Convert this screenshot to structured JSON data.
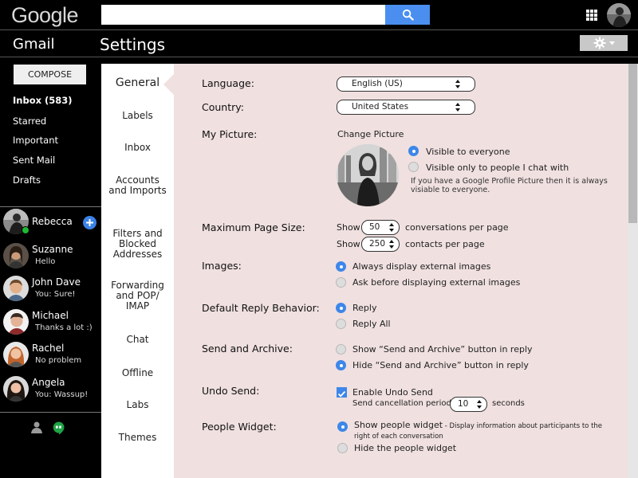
{
  "header": {
    "logo": "Google",
    "search_placeholder": "",
    "app_label": "Gmail",
    "page_title": "Settings"
  },
  "nav": {
    "compose_label": "COMPOSE",
    "items": [
      {
        "label": "Inbox (583)"
      },
      {
        "label": "Starred"
      },
      {
        "label": "Important"
      },
      {
        "label": "Sent Mail"
      },
      {
        "label": "Drafts"
      }
    ]
  },
  "chat": {
    "me": {
      "name": "Rebecca",
      "online": true
    },
    "contacts": [
      {
        "name": "Suzanne",
        "status": "Hello"
      },
      {
        "name": "John Dave",
        "status": "You: Sure!"
      },
      {
        "name": "Michael",
        "status": "Thanks a lot :)"
      },
      {
        "name": "Rachel",
        "status": "No problem"
      },
      {
        "name": "Angela",
        "status": "You: Wassup!"
      }
    ]
  },
  "tabs": [
    {
      "label": "General",
      "active": true
    },
    {
      "label": "Labels"
    },
    {
      "label": "Inbox"
    },
    {
      "label": "Accounts and Imports"
    },
    {
      "label": "Filters and Blocked Addresses"
    },
    {
      "label": "Forwarding and POP/ IMAP"
    },
    {
      "label": "Chat"
    },
    {
      "label": "Offline"
    },
    {
      "label": "Labs"
    },
    {
      "label": "Themes"
    }
  ],
  "settings": {
    "language": {
      "label": "Language:",
      "value": "English (US)"
    },
    "country": {
      "label": "Country:",
      "value": "United States"
    },
    "picture": {
      "label": "My Picture:",
      "change_link": "Change Picture",
      "opt_visible_all": "Visible to everyone",
      "opt_visible_chat": "Visible only to people I chat with",
      "note": "If you have a Google Profile Picture then it is always visiable to everyone."
    },
    "page_size": {
      "label": "Maximum Page Size:",
      "show1": "Show",
      "conversations_value": "50",
      "conversations_suffix": "conversations per page",
      "show2": "Show",
      "contacts_value": "250",
      "contacts_suffix": "contacts per page"
    },
    "images": {
      "label": "Images:",
      "opt_always": "Always display external images",
      "opt_ask": "Ask before displaying external images"
    },
    "reply": {
      "label": "Default Reply Behavior:",
      "opt_reply": "Reply",
      "opt_reply_all": "Reply All"
    },
    "send_archive": {
      "label": "Send and Archive:",
      "opt_show": "Show “Send and Archive” button in reply",
      "opt_hide": "Hide “Send and Archive” button in reply"
    },
    "undo": {
      "label": "Undo Send:",
      "enable": "Enable Undo Send",
      "period_label": "Send cancellation period:",
      "period_value": "10",
      "period_unit": "seconds"
    },
    "people": {
      "label": "People Widget:",
      "opt_show": "Show people widget",
      "opt_show_desc": " - Display information about participants to the right of each conversation",
      "opt_hide": "Hide the people widget"
    }
  },
  "colors": {
    "accent": "#3d87e9",
    "search_button": "#4a8ef0",
    "content_bg": "#f0e0e0",
    "online": "#1fb833"
  }
}
